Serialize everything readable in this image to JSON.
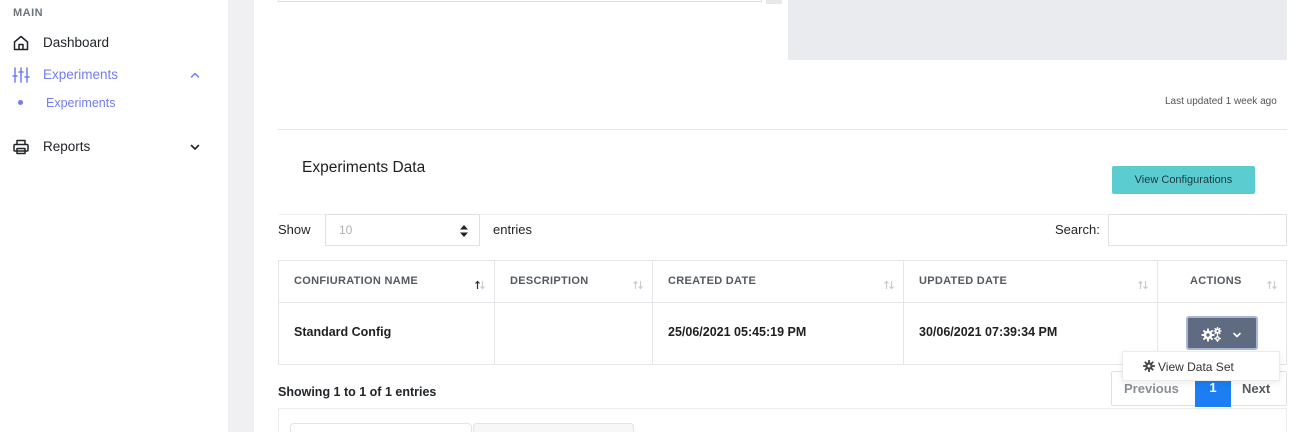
{
  "sidebar": {
    "section_title": "MAIN",
    "items": [
      {
        "label": "Dashboard",
        "icon": "home-icon"
      },
      {
        "label": "Experiments",
        "icon": "sliders-icon",
        "active": true,
        "expanded": true
      },
      {
        "label": "Reports",
        "icon": "printer-icon"
      }
    ],
    "sub_items": [
      {
        "label": "Experiments",
        "active": true
      }
    ]
  },
  "panel": {
    "last_updated": "Last updated 1 week ago"
  },
  "experiments": {
    "title": "Experiments Data",
    "view_config_label": "View Configurations",
    "show_label": "Show",
    "entries_value": "10",
    "entries_label": "entries",
    "search_label": "Search:",
    "search_value": "",
    "columns": [
      "CONFIURATION NAME",
      "DESCRIPTION",
      "CREATED DATE",
      "UPDATED DATE",
      "ACTIONS"
    ],
    "rows": [
      {
        "name": "Standard Config",
        "description": "",
        "created": "25/06/2021 05:45:19 PM",
        "updated": "30/06/2021 07:39:34 PM"
      }
    ],
    "action_menu": {
      "item_label": "View Data Set",
      "icon": "gear-icon"
    },
    "showing_text": "Showing 1 to 1 of 1 entries",
    "pagination": {
      "previous": "Previous",
      "current_page": "1",
      "next": "Next"
    }
  },
  "colors": {
    "accent": "#727cf5",
    "config_button": "#5bccd0",
    "action_button": "#5f6b80",
    "page_active": "#1c7ef2"
  }
}
